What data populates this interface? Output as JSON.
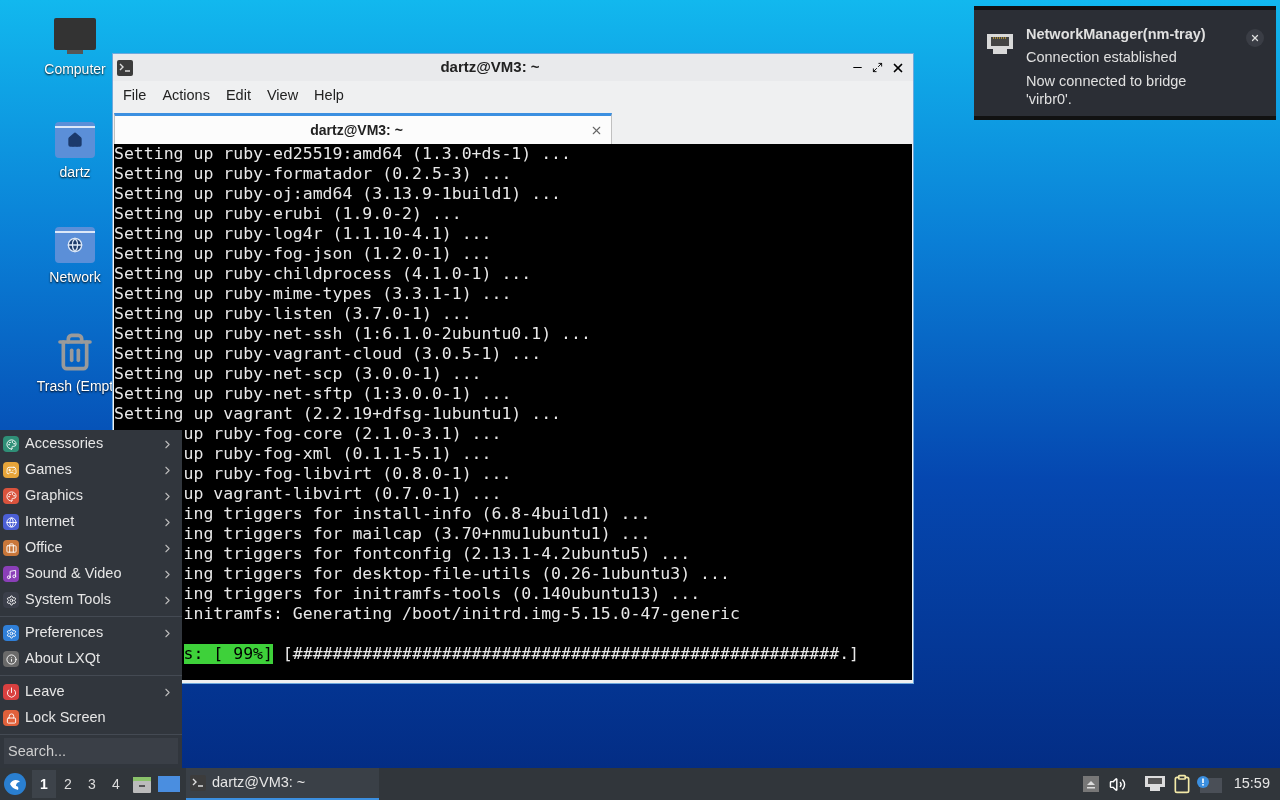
{
  "desktop_icons": [
    {
      "kind": "computer",
      "label": "Computer"
    },
    {
      "kind": "home",
      "label": "dartz"
    },
    {
      "kind": "network",
      "label": "Network"
    },
    {
      "kind": "trash",
      "label": "Trash (Empt"
    }
  ],
  "terminal": {
    "title": "dartz@VM3: ~",
    "menu": [
      "File",
      "Actions",
      "Edit",
      "View",
      "Help"
    ],
    "tab": {
      "title": "dartz@VM3: ~",
      "selected": true
    },
    "lines": [
      {
        "kind": "text",
        "covered": false,
        "text": "Setting up ruby-ed25519:amd64 (1.3.0+ds-1) ..."
      },
      {
        "kind": "text",
        "covered": false,
        "text": "Setting up ruby-formatador (0.2.5-3) ..."
      },
      {
        "kind": "text",
        "covered": false,
        "text": "Setting up ruby-oj:amd64 (3.13.9-1build1) ..."
      },
      {
        "kind": "text",
        "covered": false,
        "text": "Setting up ruby-erubi (1.9.0-2) ..."
      },
      {
        "kind": "text",
        "covered": false,
        "text": "Setting up ruby-log4r (1.1.10-4.1) ..."
      },
      {
        "kind": "text",
        "covered": false,
        "text": "Setting up ruby-fog-json (1.2.0-1) ..."
      },
      {
        "kind": "text",
        "covered": false,
        "text": "Setting up ruby-childprocess (4.1.0-1) ..."
      },
      {
        "kind": "text",
        "covered": false,
        "text": "Setting up ruby-mime-types (3.3.1-1) ..."
      },
      {
        "kind": "text",
        "covered": false,
        "text": "Setting up ruby-listen (3.7.0-1) ..."
      },
      {
        "kind": "text",
        "covered": false,
        "text": "Setting up ruby-net-ssh (1:6.1.0-2ubuntu0.1) ..."
      },
      {
        "kind": "text",
        "covered": false,
        "text": "Setting up ruby-vagrant-cloud (3.0.5-1) ..."
      },
      {
        "kind": "text",
        "covered": false,
        "text": "Setting up ruby-net-scp (3.0.0-1) ..."
      },
      {
        "kind": "text",
        "covered": false,
        "text": "Setting up ruby-net-sftp (1:3.0.0-1) ..."
      },
      {
        "kind": "text",
        "covered": false,
        "text": "Setting up vagrant (2.2.19+dfsg-1ubuntu1) ..."
      },
      {
        "kind": "text",
        "covered": true,
        "text": "up ruby-fog-core (2.1.0-3.1) ..."
      },
      {
        "kind": "text",
        "covered": true,
        "text": "up ruby-fog-xml (0.1.1-5.1) ..."
      },
      {
        "kind": "text",
        "covered": true,
        "text": "up ruby-fog-libvirt (0.8.0-1) ..."
      },
      {
        "kind": "text",
        "covered": true,
        "text": "up vagrant-libvirt (0.7.0-1) ..."
      },
      {
        "kind": "text",
        "covered": true,
        "text": "ing triggers for install-info (6.8-4build1) ..."
      },
      {
        "kind": "text",
        "covered": true,
        "text": "ing triggers for mailcap (3.70+nmu1ubuntu1) ..."
      },
      {
        "kind": "text",
        "covered": true,
        "text": "ing triggers for fontconfig (2.13.1-4.2ubuntu5) ..."
      },
      {
        "kind": "text",
        "covered": true,
        "text": "ing triggers for desktop-file-utils (0.26-1ubuntu3) ..."
      },
      {
        "kind": "text",
        "covered": true,
        "text": "ing triggers for initramfs-tools (0.140ubuntu13) ..."
      },
      {
        "kind": "text",
        "covered": true,
        "text": "initramfs: Generating /boot/initrd.img-5.15.0-47-generic"
      },
      {
        "kind": "blank"
      },
      {
        "kind": "progress",
        "covered": true,
        "label": "s: [ 99%]",
        "text": "[#######################################################.]"
      }
    ]
  },
  "notification": {
    "title": "NetworkManager(nm-tray)",
    "summary": "Connection established",
    "body": "Now connected to bridge 'virbr0'."
  },
  "app_menu": {
    "sections": [
      [
        {
          "label": "Accessories",
          "submenu": true
        },
        {
          "label": "Games",
          "submenu": true
        },
        {
          "label": "Graphics",
          "submenu": true
        },
        {
          "label": "Internet",
          "submenu": true
        },
        {
          "label": "Office",
          "submenu": true
        },
        {
          "label": "Sound & Video",
          "submenu": true
        },
        {
          "label": "System Tools",
          "submenu": true
        }
      ],
      [
        {
          "label": "Preferences",
          "submenu": true
        },
        {
          "label": "About LXQt",
          "submenu": false
        }
      ],
      [
        {
          "label": "Leave",
          "submenu": true
        },
        {
          "label": "Lock Screen",
          "submenu": false
        }
      ]
    ],
    "search": {
      "placeholder": "Search..."
    }
  },
  "taskbar": {
    "desktops": [
      {
        "label": "1",
        "selected": true
      },
      {
        "label": "2",
        "selected": false
      },
      {
        "label": "3",
        "selected": false
      },
      {
        "label": "4",
        "selected": false
      }
    ],
    "tasks": [
      {
        "title": "dartz@VM3: ~",
        "selected": true
      }
    ],
    "clock": "15:59"
  }
}
